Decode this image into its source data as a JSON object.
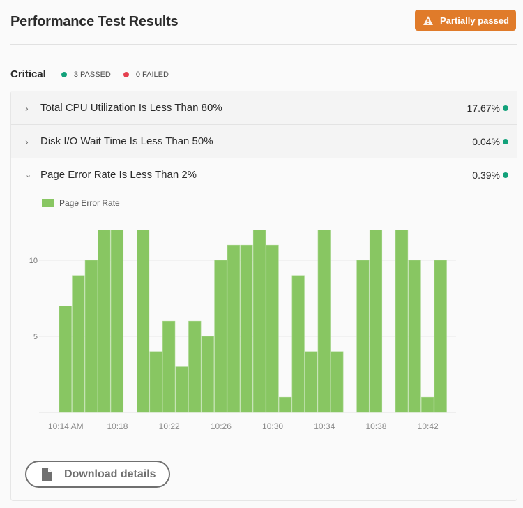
{
  "header": {
    "title": "Performance Test Results",
    "status_badge": {
      "label": "Partially passed",
      "icon": "warning-icon",
      "color": "#e07b2a"
    }
  },
  "critical": {
    "label": "Critical",
    "passed": "3 PASSED",
    "failed": "0 FAILED",
    "passed_color": "#12a17a",
    "failed_color": "#e5404f"
  },
  "tests": [
    {
      "label": "Total CPU Utilization Is Less Than 80%",
      "value": "17.67%",
      "expanded": false,
      "status": "passed"
    },
    {
      "label": "Disk I/O Wait Time Is Less Than 50%",
      "value": "0.04%",
      "expanded": false,
      "status": "passed"
    },
    {
      "label": "Page Error Rate Is Less Than 2%",
      "value": "0.39%",
      "expanded": true,
      "status": "passed"
    }
  ],
  "chart_data": {
    "type": "bar",
    "title": "",
    "legend": [
      "Page Error Rate"
    ],
    "legend_position": "top-left",
    "xlabel": "",
    "ylabel": "",
    "ylim": [
      0,
      12
    ],
    "yticks": [
      5,
      10
    ],
    "grid": true,
    "color": "#88c662",
    "x_tick_labels": [
      "10:14 AM",
      "10:18",
      "10:22",
      "10:26",
      "10:30",
      "10:34",
      "10:38",
      "10:42"
    ],
    "series": [
      {
        "name": "Page Error Rate",
        "values": [
          7,
          9,
          10,
          12,
          12,
          0,
          12,
          4,
          6,
          3,
          6,
          5,
          10,
          11,
          11,
          12,
          11,
          1,
          9,
          4,
          12,
          4,
          0,
          10,
          12,
          0,
          12,
          10,
          1,
          10
        ]
      }
    ]
  },
  "actions": {
    "download_label": "Download details",
    "download_icon": "file-icon"
  }
}
